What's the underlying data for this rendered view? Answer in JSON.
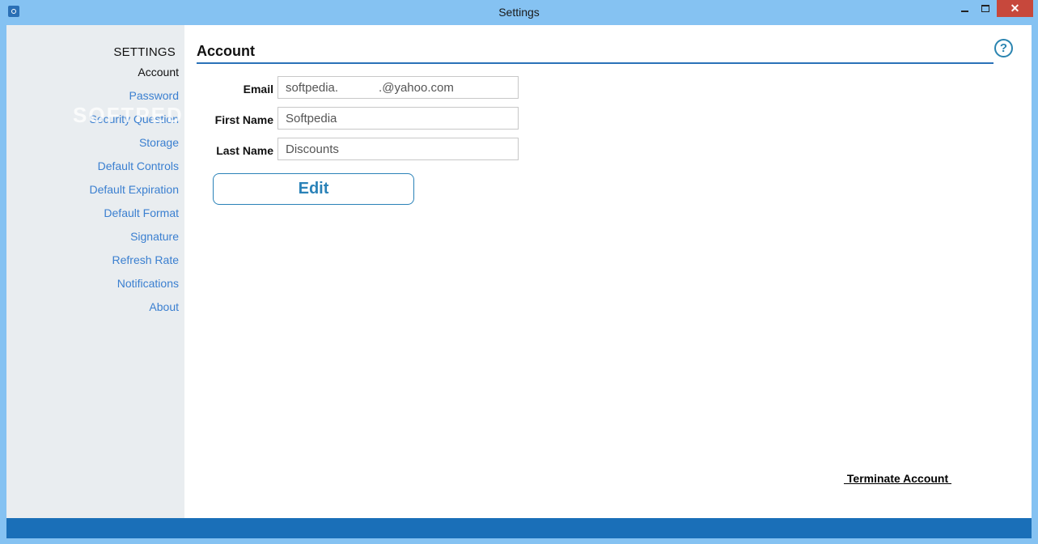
{
  "window": {
    "title": "Settings",
    "close_glyph": "✕"
  },
  "sidebar": {
    "heading": "SETTINGS",
    "watermark": "SOFTPEDIA",
    "items": [
      {
        "label": "Account",
        "active": true
      },
      {
        "label": "Password"
      },
      {
        "label": "Security Question"
      },
      {
        "label": "Storage"
      },
      {
        "label": "Default Controls"
      },
      {
        "label": "Default Expiration"
      },
      {
        "label": "Default Format"
      },
      {
        "label": "Signature"
      },
      {
        "label": "Refresh Rate"
      },
      {
        "label": "Notifications"
      },
      {
        "label": "About"
      }
    ]
  },
  "account": {
    "title": "Account",
    "help_glyph": "?",
    "fields": {
      "email_label": "Email",
      "email_value": "softpedia.            .@yahoo.com",
      "first_name_label": "First Name",
      "first_name_value": "Softpedia",
      "last_name_label": "Last Name",
      "last_name_value": "Discounts"
    },
    "edit_label": "Edit",
    "terminate_label": " Terminate Account "
  },
  "colors": {
    "accent": "#2a72b8",
    "link": "#3a7fd0",
    "window_frame": "#85c2f2",
    "status_bar": "#1a6fb8",
    "close_button": "#c7483c"
  }
}
